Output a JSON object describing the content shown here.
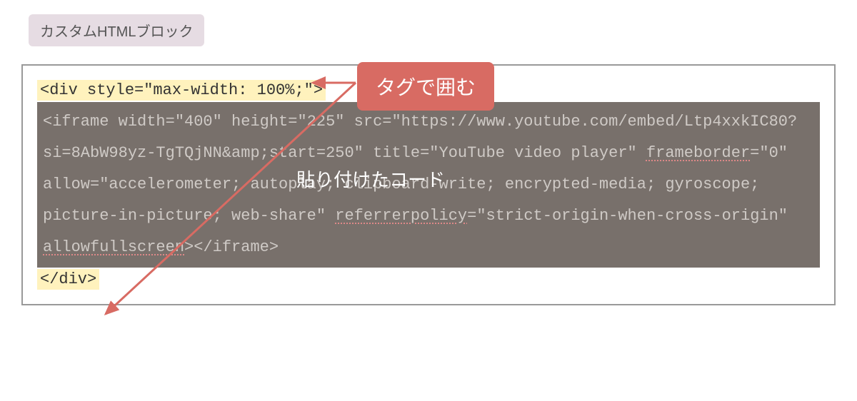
{
  "block_label": "カスタムHTMLブロック",
  "code": {
    "highlight_open": "<div style=\"max-width: 100%;\">",
    "iframe_text_parts": {
      "p1": "<iframe width=\"400\" height=\"225\" src=\"https://www.youtube.com/embed/Ltp4xxkIC80?si=8AbW98yz-TgTQjNN&amp;start=250\" title=\"YouTube video player\" ",
      "u1": "frameborder",
      "p2": "=\"0\" allow=\"accelerometer; autoplay; clipboard-write; encrypted-media; gyroscope; picture-in-picture; web-share\" ",
      "u2": "referrerpolicy",
      "p3": "=\"strict-origin-when-cross-origin\" ",
      "u3": "allowfullscreen",
      "p4": "></iframe>"
    },
    "highlight_close": "</div>"
  },
  "callouts": {
    "tag_wrap": "タグで囲む",
    "pasted_code": "貼り付けたコード"
  }
}
